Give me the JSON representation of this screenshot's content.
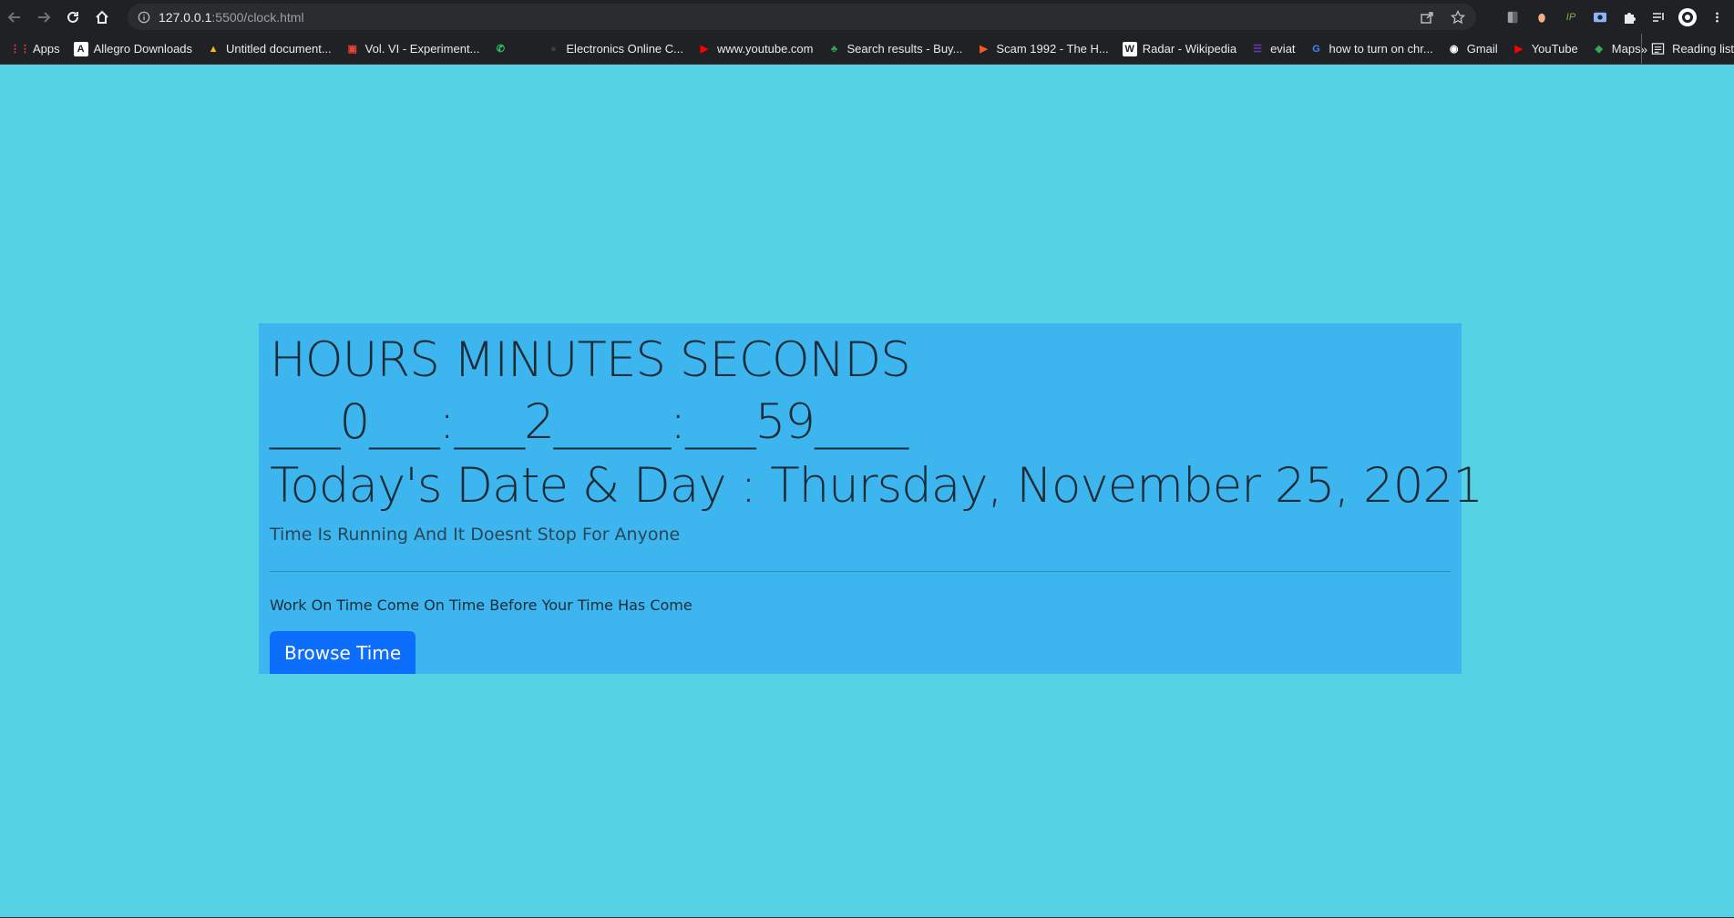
{
  "browser": {
    "url_host": "127.0.0.1",
    "url_path": ":5500/clock.html"
  },
  "bookmarks": {
    "items": [
      {
        "label": "Apps",
        "icon": "apps-grid-icon",
        "color": "#ea4335"
      },
      {
        "label": "Allegro Downloads",
        "icon": "allegro-icon",
        "color": "#ffffff"
      },
      {
        "label": "Untitled document...",
        "icon": "google-drive-icon",
        "color": "#fbbc04"
      },
      {
        "label": "Vol. VI - Experiment...",
        "icon": "chip-icon",
        "color": "#ea4335"
      },
      {
        "label": "",
        "icon": "whatsapp-icon",
        "color": "#25d366"
      },
      {
        "label": "Electronics Online C...",
        "icon": "store-icon",
        "color": "#3c4043"
      },
      {
        "label": "www.youtube.com",
        "icon": "youtube-icon",
        "color": "#ff0000"
      },
      {
        "label": "Search results - Buy...",
        "icon": "tree-icon",
        "color": "#34a853"
      },
      {
        "label": "Scam 1992 - The H...",
        "icon": "play-icon",
        "color": "#ff5722"
      },
      {
        "label": "Radar - Wikipedia",
        "icon": "wikipedia-icon",
        "color": "#ffffff"
      },
      {
        "label": "eviat",
        "icon": "list-icon",
        "color": "#673ab7"
      },
      {
        "label": "how to turn on chr...",
        "icon": "google-icon",
        "color": "#4285f4"
      },
      {
        "label": "Gmail",
        "icon": "globe-icon",
        "color": "#ffffff"
      },
      {
        "label": "YouTube",
        "icon": "youtube-icon",
        "color": "#ff0000"
      },
      {
        "label": "Maps",
        "icon": "maps-icon",
        "color": "#34a853"
      }
    ],
    "overflow": "»",
    "reading_list": "Reading list"
  },
  "clock": {
    "headings": "HOURS MINUTES SECONDS",
    "time": "___0___:___2_____:___59____",
    "date": "Today's Date & Day : Thursday, November 25, 2021",
    "subtitle": "Time Is Running And It Doesnt Stop For Anyone",
    "quote": "Work On Time Come On Time Before Your Time Has Come",
    "button_label": "Browse Time"
  },
  "colors": {
    "page_bg": "#55d3e5",
    "card_bg": "#3db6f0",
    "button_bg": "#0d6efd",
    "text": "#1c2b36"
  }
}
